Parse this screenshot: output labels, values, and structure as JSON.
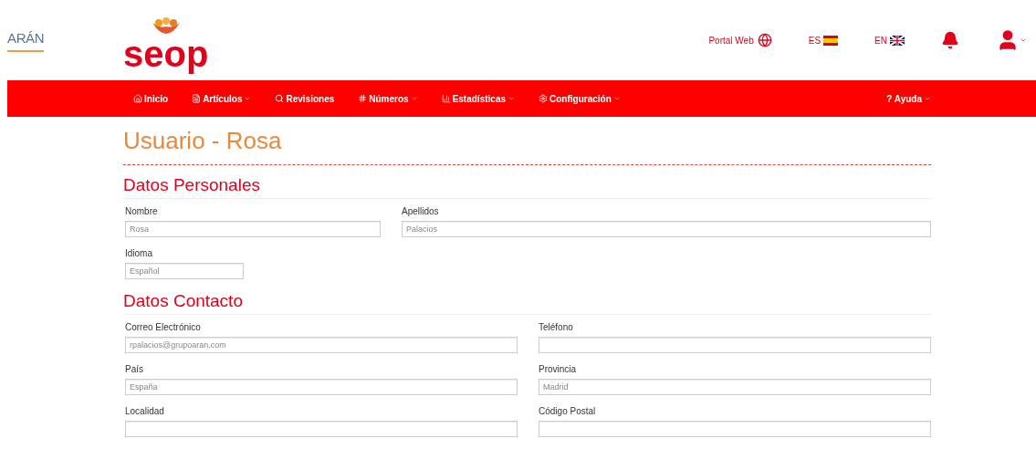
{
  "logos": {
    "aran": "ARÁN",
    "seop": "seop"
  },
  "top_links": {
    "portal": "Portal Web",
    "languages": [
      {
        "code": "ES",
        "kind": "spain"
      },
      {
        "code": "EN",
        "kind": "uk"
      }
    ]
  },
  "nav": {
    "items": [
      {
        "label": "Inicio",
        "dropdown": false
      },
      {
        "label": "Artículos",
        "dropdown": true
      },
      {
        "label": "Revisiones",
        "dropdown": false
      },
      {
        "label": "Números",
        "dropdown": true
      },
      {
        "label": "Estadísticas",
        "dropdown": true
      },
      {
        "label": "Configuración",
        "dropdown": true
      }
    ],
    "help": {
      "label": "Ayuda",
      "icon": "?",
      "dropdown": true
    }
  },
  "page_title": "Usuario - Rosa",
  "sections": [
    {
      "title": "Datos Personales",
      "rows": [
        [
          {
            "label": "Nombre",
            "value": "Rosa"
          },
          {
            "label": "Apellidos",
            "value": "Palacios"
          }
        ],
        [
          {
            "label": "Idioma",
            "value": "Español"
          }
        ]
      ]
    },
    {
      "title": "Datos Contacto",
      "rows": [
        [
          {
            "label": "Correo Electrónico",
            "value": "rpalacios@grupoaran.com"
          },
          {
            "label": "Teléfono"
          }
        ],
        [
          {
            "label": "País",
            "value": "España"
          },
          {
            "label": "Provincia",
            "value": "Madrid"
          }
        ],
        [
          {
            "label": "Localidad"
          },
          {
            "label": "Código Postal"
          }
        ]
      ]
    }
  ]
}
